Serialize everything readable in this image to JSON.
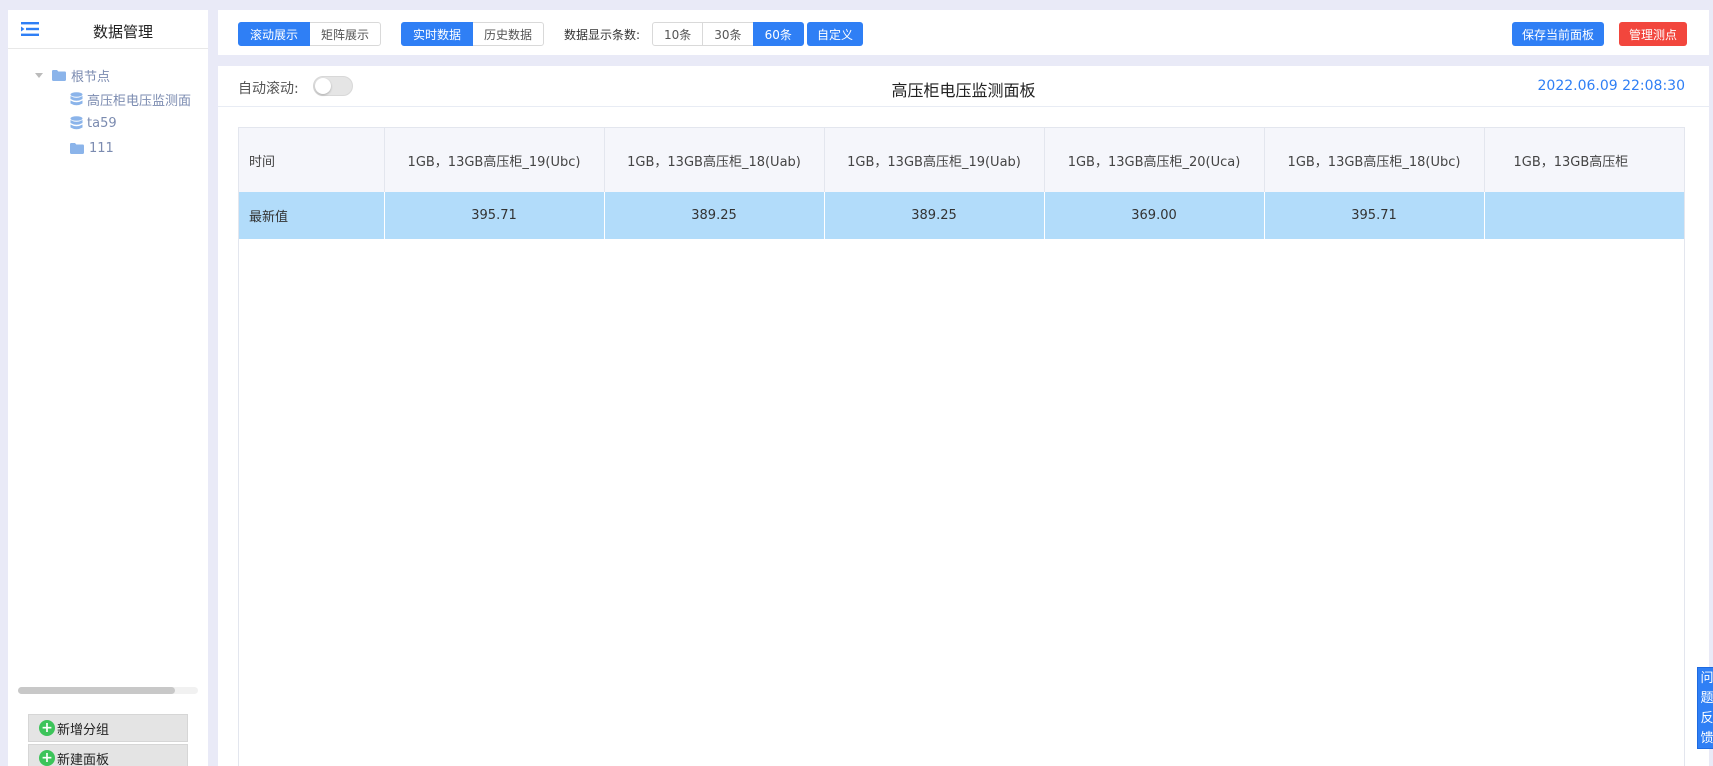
{
  "sidebar": {
    "title": "数据管理",
    "tree": {
      "root": "根节点",
      "children": [
        "高压柜电压监测面",
        "ta59",
        "111"
      ]
    },
    "add_group_label": "新增分组",
    "new_panel_label": "新建面板"
  },
  "toolbar": {
    "view_modes": [
      "滚动展示",
      "矩阵展示"
    ],
    "view_mode_selected": "滚动展示",
    "data_modes": [
      "实时数据",
      "历史数据"
    ],
    "data_mode_selected": "实时数据",
    "count_label": "数据显示条数:",
    "counts": [
      "10条",
      "30条",
      "60条"
    ],
    "count_selected": "60条",
    "custom_label": "自定义",
    "save_label": "保存当前面板",
    "manage_label": "管理测点"
  },
  "panel": {
    "auto_scroll_label": "自动滚动:",
    "auto_scroll_on": false,
    "title": "高压柜电压监测面板",
    "timestamp": "2022.06.09 22:08:30"
  },
  "table": {
    "columns": [
      "时间",
      "1GB，13GB高压柜_19(Ubc)",
      "1GB，13GB高压柜_18(Uab)",
      "1GB，13GB高压柜_19(Uab)",
      "1GB，13GB高压柜_20(Uca)",
      "1GB，13GB高压柜_18(Ubc)",
      "1GB，13GB高压柜"
    ],
    "rows": [
      [
        "最新值",
        "395.71",
        "389.25",
        "389.25",
        "369.00",
        "395.71",
        ""
      ]
    ]
  },
  "feedback": {
    "chars": [
      "问",
      "题",
      "反",
      "馈"
    ]
  },
  "colors": {
    "accent": "#2f7ff5",
    "danger": "#f2463d",
    "row_highlight": "#b2dcfa",
    "page_bg": "#e9eaf7"
  }
}
